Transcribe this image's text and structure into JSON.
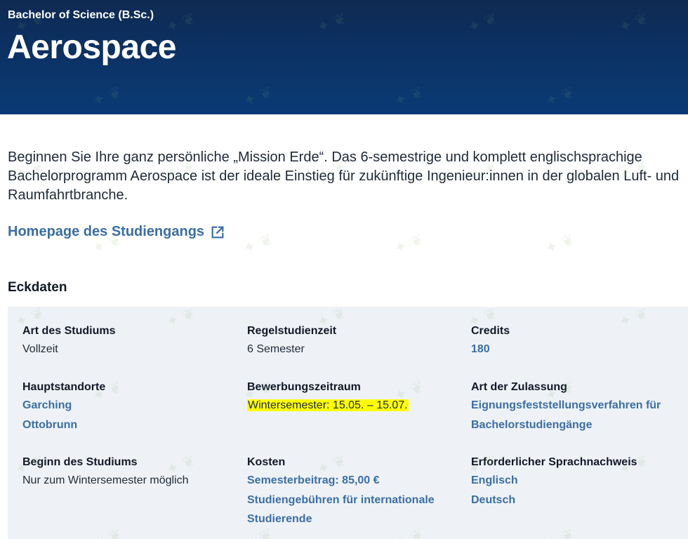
{
  "header": {
    "degree": "Bachelor of Science (B.Sc.)",
    "title": "Aerospace"
  },
  "intro": {
    "text": "Beginnen Sie Ihre ganz persönliche „Mission Erde“. Das 6-semestrige und komplett englischsprachige Bachelorprogramm Aerospace ist der ideale Einstieg für zukünftige Ingenieur:innen in der globalen Luft- und Raumfahrtbranche."
  },
  "homepage": {
    "label": "Homepage des Studiengangs",
    "icon": "external-link-icon"
  },
  "eckdaten": {
    "heading": "Eckdaten",
    "art_des_studiums": {
      "label": "Art des Studiums",
      "value": "Vollzeit"
    },
    "regelstudienzeit": {
      "label": "Regelstudienzeit",
      "value": "6 Semester"
    },
    "credits": {
      "label": "Credits",
      "value": "180"
    },
    "hauptstandorte": {
      "label": "Hauptstandorte",
      "values": [
        "Garching",
        "Ottobrunn"
      ]
    },
    "bewerbungszeitraum": {
      "label": "Bewerbungszeitraum",
      "value": "Wintersemester: 15.05. – 15.07."
    },
    "art_der_zulassung": {
      "label": "Art der Zulassung",
      "values": [
        "Eignungsfeststellungsverfahren für",
        "Bachelorstudiengänge"
      ]
    },
    "beginn": {
      "label": "Beginn des Studiums",
      "value": "Nur zum Wintersemester möglich"
    },
    "kosten": {
      "label": "Kosten",
      "values": [
        "Semesterbeitrag: 85,00 €",
        "Studiengebühren für internationale",
        "Studierende"
      ]
    },
    "sprachnachweis": {
      "label": "Erforderlicher Sprachnachweis",
      "values": [
        "Englisch",
        "Deutsch"
      ]
    }
  },
  "colors": {
    "header_bg": "#0b3469",
    "link": "#3a6ea5",
    "facts_bg": "#eef2f6",
    "highlight": "#ffff00"
  }
}
